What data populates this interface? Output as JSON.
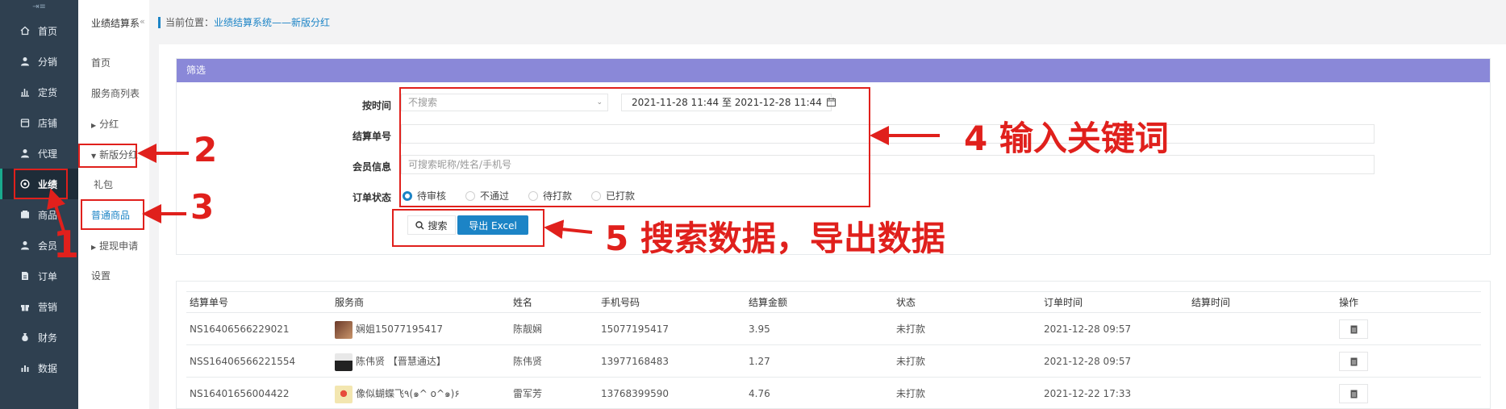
{
  "nav": {
    "toggle_glyph": "⇥≡",
    "items": [
      {
        "label": "首页",
        "icon": "home-icon"
      },
      {
        "label": "分销",
        "icon": "user-icon"
      },
      {
        "label": "定货",
        "icon": "bar-chart-icon"
      },
      {
        "label": "店铺",
        "icon": "store-icon"
      },
      {
        "label": "代理",
        "icon": "user-icon"
      },
      {
        "label": "业绩",
        "icon": "performance-icon",
        "active": true
      },
      {
        "label": "商品",
        "icon": "product-icon"
      },
      {
        "label": "会员",
        "icon": "member-icon"
      },
      {
        "label": "订单",
        "icon": "order-icon"
      },
      {
        "label": "营销",
        "icon": "gift-icon"
      },
      {
        "label": "财务",
        "icon": "money-bag-icon"
      },
      {
        "label": "数据",
        "icon": "data-chart-icon"
      }
    ]
  },
  "subnav": {
    "title": "业绩结算系",
    "collapse_glyph": "«",
    "items": [
      "首页",
      "服务商列表",
      "分红",
      "新版分红",
      "礼包",
      "普通商品",
      "提现申请",
      "设置"
    ]
  },
  "breadcrumb": {
    "prefix": "当前位置：",
    "path": "业绩结算系统——新版分红"
  },
  "filter": {
    "header": "筛选",
    "time_label": "按时间",
    "time_select": "不搜索",
    "date_range": "2021-11-28 11:44 至 2021-12-28 11:44",
    "order_no_label": "结算单号",
    "order_no_value": "",
    "member_label": "会员信息",
    "member_placeholder": "可搜索昵称/姓名/手机号",
    "status_label": "订单状态",
    "status_options": [
      "待审核",
      "不通过",
      "待打款",
      "已打款"
    ],
    "status_selected": 0,
    "search_btn": "搜索",
    "export_btn": "导出 Excel"
  },
  "table": {
    "columns": [
      "结算单号",
      "服务商",
      "姓名",
      "手机号码",
      "结算金额",
      "状态",
      "订单时间",
      "结算时间",
      "操作"
    ],
    "rows": [
      {
        "no": "NS16406566229021",
        "provider": "娴姐15077195417",
        "name": "陈靓娴",
        "phone": "15077195417",
        "amount": "3.95",
        "status": "未打款",
        "order_time": "2021-12-28 09:57",
        "settle_time": ""
      },
      {
        "no": "NSS16406566221554",
        "provider": "陈伟贤 【晋慧通达】",
        "name": "陈伟贤",
        "phone": "13977168483",
        "amount": "1.27",
        "status": "未打款",
        "order_time": "2021-12-28 09:57",
        "settle_time": ""
      },
      {
        "no": "NS16401656004422",
        "provider": "像似蝴蝶飞٩(๑^ o^๑)۶",
        "name": "雷军芳",
        "phone": "13768399590",
        "amount": "4.76",
        "status": "未打款",
        "order_time": "2021-12-22 17:33",
        "settle_time": ""
      }
    ]
  },
  "annotations": {
    "a1": "1",
    "a2": "2",
    "a3": "3",
    "a4": "4 输入关键词",
    "a5": "5 搜索数据，导出数据"
  },
  "colors": {
    "nav_bg": "#2f4050",
    "accent": "#1c84c6",
    "filter_header": "#8a88d8",
    "annotation": "#e0201c"
  }
}
